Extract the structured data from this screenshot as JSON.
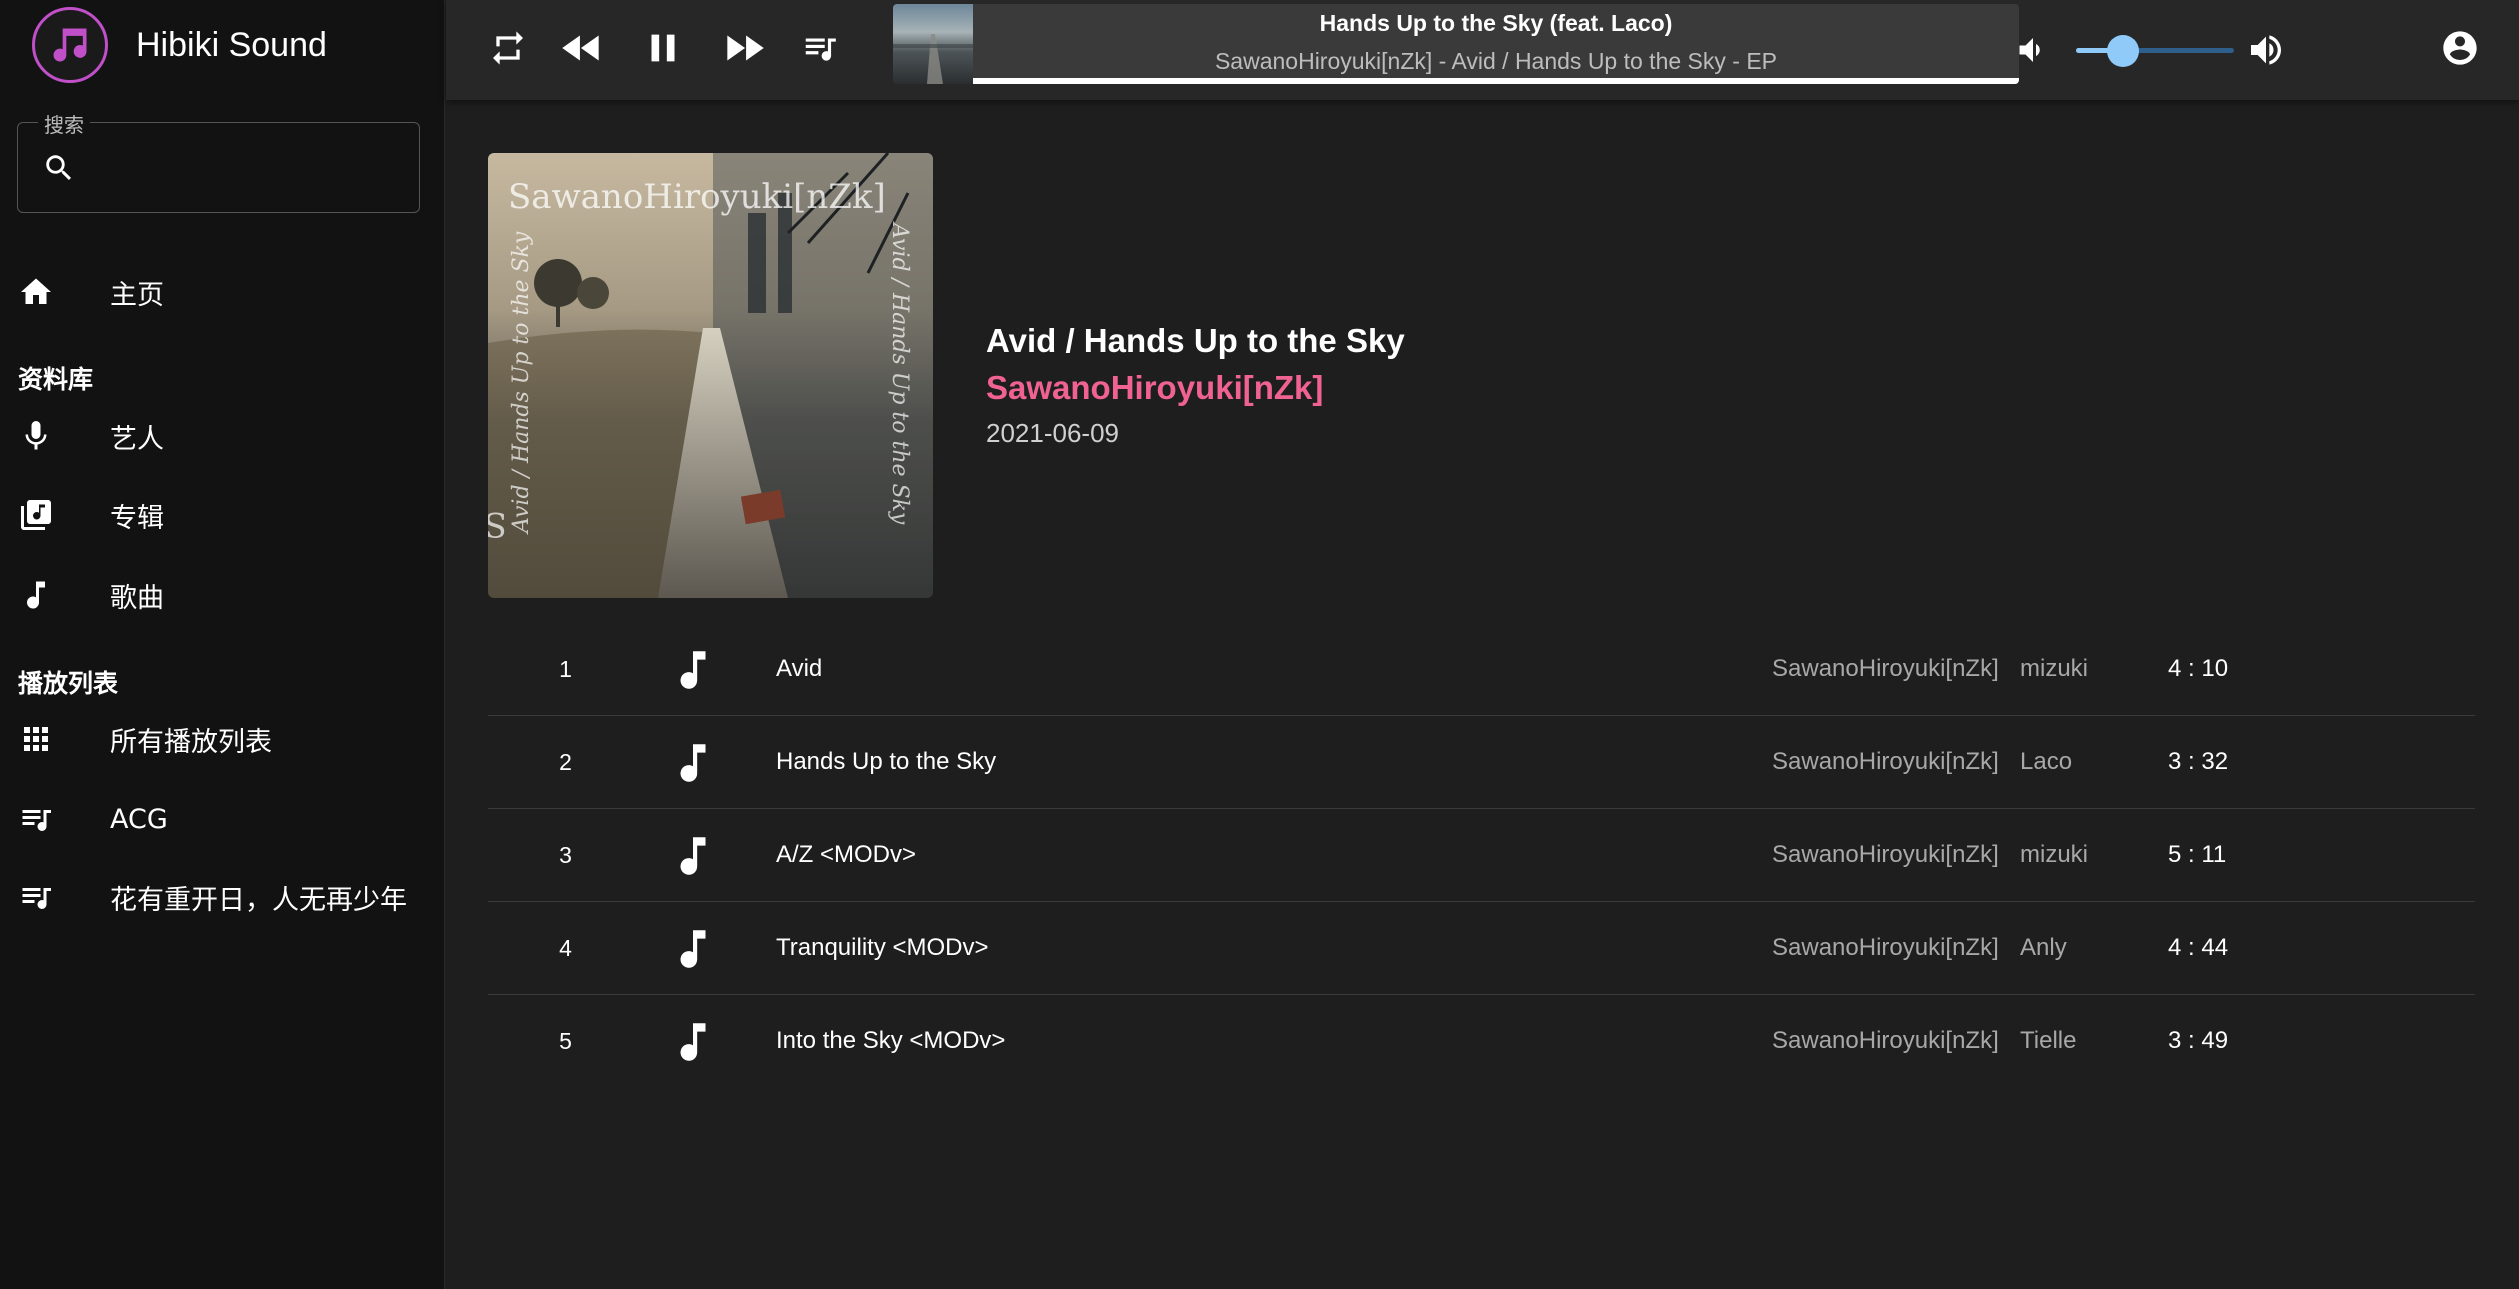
{
  "app": {
    "name": "Hibiki Sound",
    "logo_icon": "music-note-icon",
    "accent_color": "#c04fc8"
  },
  "search": {
    "label": "搜索",
    "placeholder": "",
    "value": ""
  },
  "sidebar": {
    "home": {
      "label": "主页",
      "icon": "home-icon"
    },
    "library_title": "资料库",
    "library_items": [
      {
        "label": "艺人",
        "icon": "microphone-icon"
      },
      {
        "label": "专辑",
        "icon": "album-library-icon"
      },
      {
        "label": "歌曲",
        "icon": "music-note-icon"
      }
    ],
    "playlists_title": "播放列表",
    "playlist_items": [
      {
        "label": "所有播放列表",
        "icon": "grid-icon"
      },
      {
        "label": "ACG",
        "icon": "queue-music-icon"
      },
      {
        "label": "花有重开日，人无再少年",
        "icon": "queue-music-icon"
      }
    ]
  },
  "player": {
    "controls": [
      "repeat-icon",
      "previous-icon",
      "pause-icon",
      "next-icon",
      "queue-icon"
    ],
    "now_playing_title": "Hands Up to the Sky (feat. Laco)",
    "now_playing_subtitle": "SawanoHiroyuki[nZk] - Avid / Hands Up to the Sky - EP",
    "progress": 1.0,
    "volume": 0.3,
    "volume_color": "#90caf9"
  },
  "album": {
    "title": "Avid / Hands Up to the Sky",
    "artist": "SawanoHiroyuki[nZk]",
    "date": "2021-06-09",
    "artist_color": "#f06292",
    "cover_text_top": "SawanoHiroyuki[nZk]",
    "cover_text_side": "Avid / Hands Up to the Sky"
  },
  "tracks": [
    {
      "number": "1",
      "title": "Avid",
      "artist": "SawanoHiroyuki[nZk]",
      "featuring": "mizuki",
      "duration": "4 : 10"
    },
    {
      "number": "2",
      "title": "Hands Up to the Sky",
      "artist": "SawanoHiroyuki[nZk]",
      "featuring": "Laco",
      "duration": "3 : 32"
    },
    {
      "number": "3",
      "title": "A/Z <MODv>",
      "artist": "SawanoHiroyuki[nZk]",
      "featuring": "mizuki",
      "duration": "5 : 11"
    },
    {
      "number": "4",
      "title": "Tranquility <MODv>",
      "artist": "SawanoHiroyuki[nZk]",
      "featuring": "Anly",
      "duration": "4 : 44"
    },
    {
      "number": "5",
      "title": "Into the Sky <MODv>",
      "artist": "SawanoHiroyuki[nZk]",
      "featuring": "Tielle",
      "duration": "3 : 49"
    }
  ]
}
